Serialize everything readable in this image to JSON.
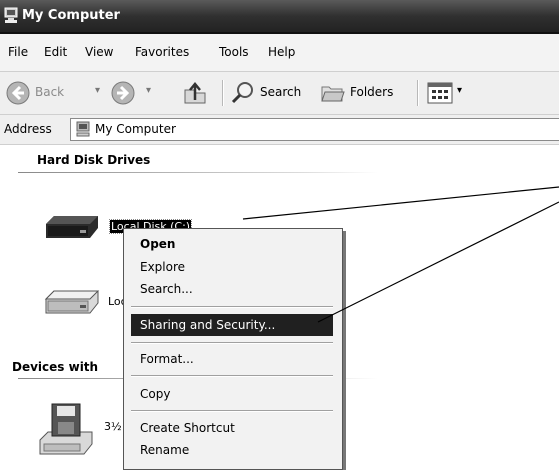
{
  "window": {
    "title": "My Computer"
  },
  "menubar": {
    "items": [
      "File",
      "Edit",
      "View",
      "Favorites",
      "Tools",
      "Help"
    ]
  },
  "toolbar": {
    "back_label": "Back",
    "search_label": "Search",
    "folders_label": "Folders"
  },
  "address": {
    "label": "Address",
    "value": "My Computer"
  },
  "sections": {
    "hard_disk_drives": "Hard Disk Drives",
    "devices_with": "Devices with"
  },
  "drives": [
    {
      "label": "Local Disk (C:)",
      "selected": true
    },
    {
      "label": "Loc"
    },
    {
      "label": "3½"
    }
  ],
  "context_menu": {
    "items": [
      {
        "label": "Open",
        "bold": true
      },
      {
        "label": "Explore"
      },
      {
        "label": "Search..."
      },
      {
        "label": "Sharing and Security...",
        "highlighted": true
      },
      {
        "label": "Format..."
      },
      {
        "label": "Copy"
      },
      {
        "label": "Create Shortcut"
      },
      {
        "label": "Rename"
      }
    ]
  },
  "icons": [
    "computer-icon",
    "back-arrow-icon",
    "forward-arrow-icon",
    "up-folder-icon",
    "search-icon",
    "folders-icon",
    "views-icon",
    "hard-disk-icon",
    "floppy-drive-icon"
  ]
}
